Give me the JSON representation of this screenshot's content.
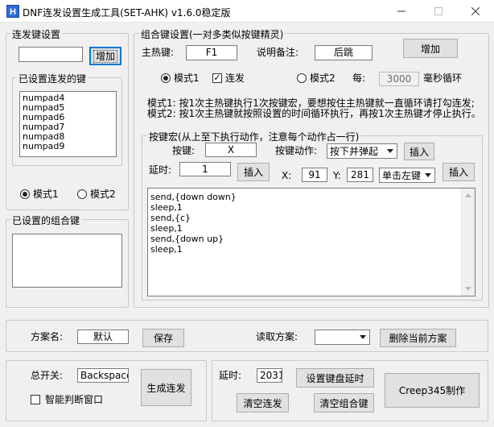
{
  "window": {
    "title": "DNF连发设置生成工具(SET-AHK) v1.6.0稳定版",
    "icons": {
      "app": "app-icon",
      "minimize": "minimize-icon",
      "maximize": "maximize-icon",
      "close": "close-icon"
    }
  },
  "burst": {
    "title": "连发键设置",
    "key_input": "",
    "add_button": "增加",
    "set_keys_title": "已设置连发的键",
    "set_keys": [
      "numpad4",
      "numpad5",
      "numpad6",
      "numpad7",
      "numpad8",
      "numpad9"
    ],
    "mode1": "模式1",
    "mode2": "模式2",
    "selected_mode": "模式1"
  },
  "combo_list": {
    "title": "已设置的组合键",
    "items": []
  },
  "combo": {
    "title": "组合键设置(一对多类似按键精灵)",
    "hotkey_label": "主热键:",
    "hotkey_value": "F1",
    "note_label": "说明备注:",
    "note_value": "后跳",
    "add_button": "增加",
    "mode1": "模式1",
    "burst_checkbox": "连发",
    "burst_checked": true,
    "mode2": "模式2",
    "every_label": "每:",
    "every_value": "3000",
    "loop_label": "毫秒循环",
    "desc1": "模式1: 按1次主热键执行1次按键宏，要想按住主热键就一直循环请打勾连发;",
    "desc2": "模式2: 按1次主热键就按照设置的时间循环执行，再按1次主热键才停止执行。"
  },
  "macro": {
    "title": "按键宏(从上至下执行动作，注意每个动作占一行)",
    "key_label": "按键:",
    "key_value": "X",
    "action_label": "按键动作:",
    "action_value": "按下并弹起",
    "insert1": "插入",
    "delay_label": "延时:",
    "delay_value": "1",
    "insert2": "插入",
    "x_label": "X:",
    "x_value": "91",
    "y_label": "Y:",
    "y_value": "281",
    "click_value": "单击左键",
    "insert3": "插入",
    "lines": [
      "send,{down down}",
      "sleep,1",
      "send,{c}",
      "sleep,1",
      "send,{down up}",
      "sleep,1"
    ]
  },
  "scheme": {
    "name_label": "方案名:",
    "name_value": "默认",
    "save_button": "保存",
    "read_label": "读取方案:",
    "read_value": "",
    "delete_button": "删除当前方案"
  },
  "bottom": {
    "master_label": "总开关:",
    "master_value": "Backspace",
    "smart_label": "智能判断窗口",
    "smart_checked": false,
    "generate_button": "生成连发",
    "delay_label": "延时:",
    "delay_value": "2031",
    "set_delay_button": "设置键盘延时",
    "clear_burst_button": "清空连发",
    "clear_combo_button": "清空组合键",
    "credit_button": "Creep345制作"
  }
}
